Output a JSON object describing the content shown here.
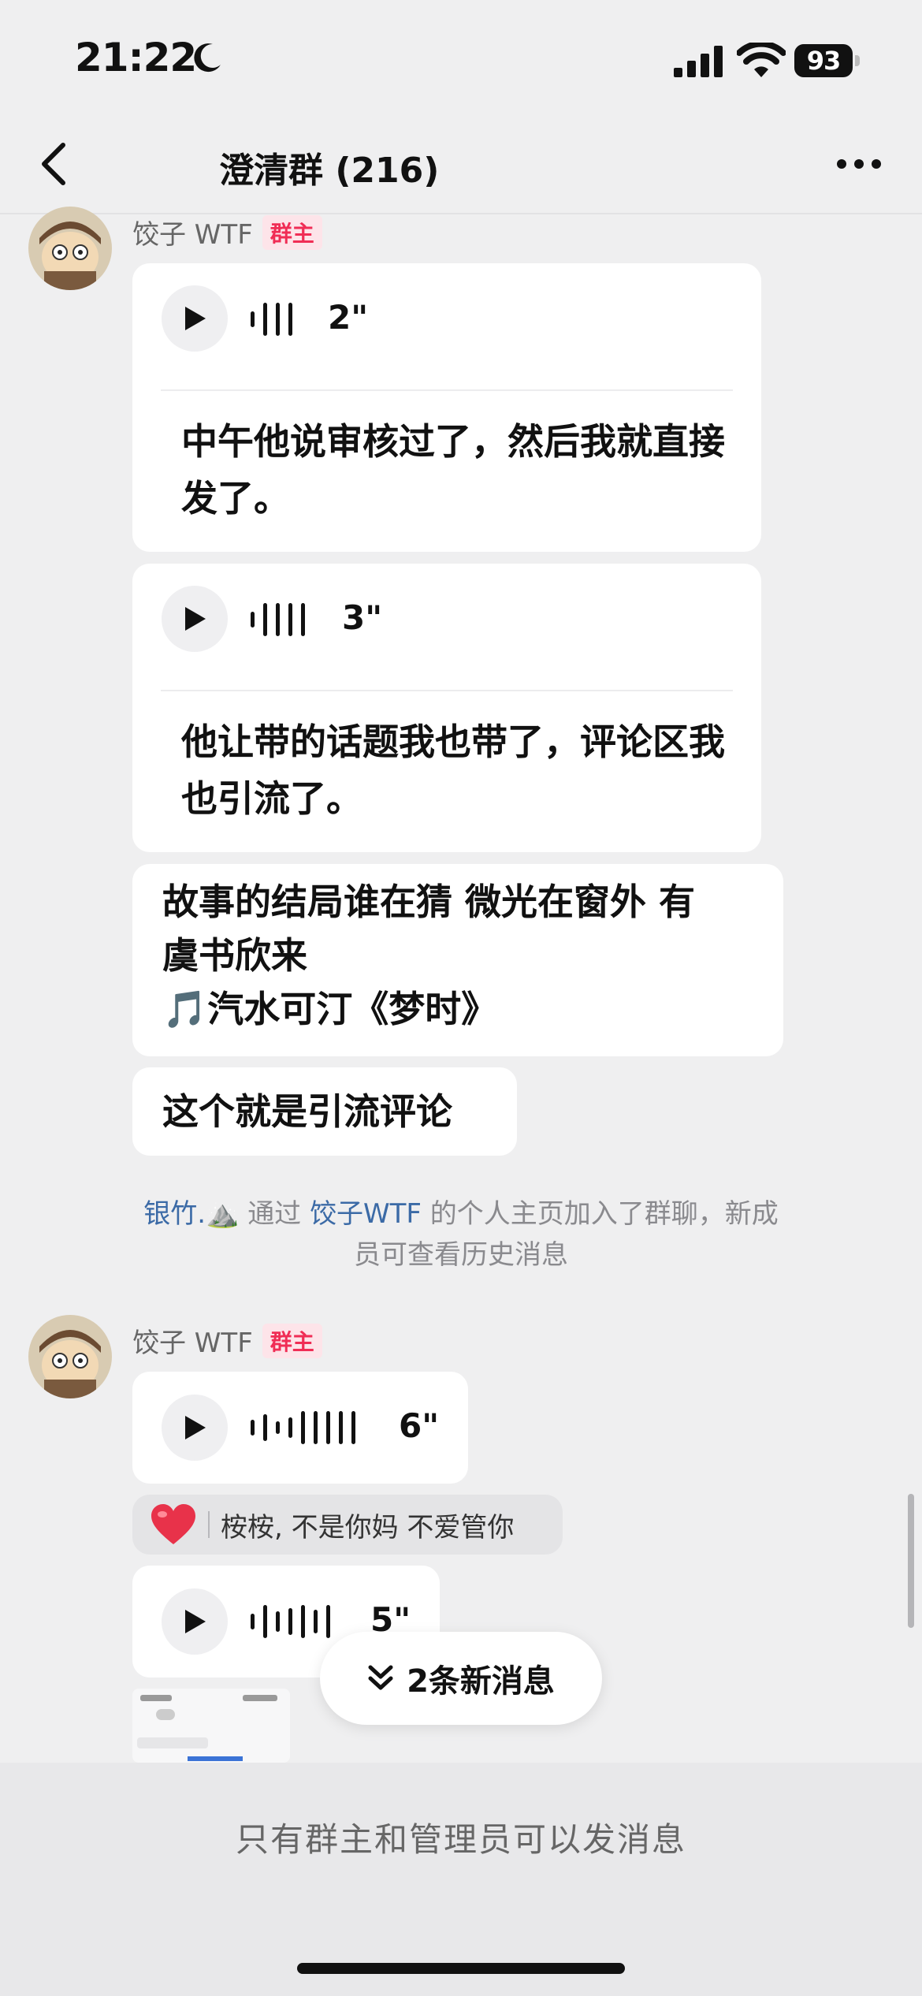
{
  "status_bar": {
    "time": "21:22",
    "battery": "93"
  },
  "nav": {
    "title": "澄清群 (216)"
  },
  "messages": {
    "sender_name": "饺子 WTF",
    "owner_badge": "群主",
    "voice1": {
      "duration": "2\"",
      "transcript": "中午他说审核过了，然后我就直接发了。"
    },
    "voice2": {
      "duration": "3\"",
      "transcript": "他让带的话题我也带了，评论区我也引流了。"
    },
    "text1": {
      "line1": "故事的结局谁在猜 微光在窗外 有",
      "line2": "虞书欣来",
      "line3": "🎵汽水可汀《梦时》"
    },
    "text2": "这个就是引流评论",
    "system_notice": {
      "user": "银竹.⛰️",
      "via": "通过",
      "inviter": "饺子WTF",
      "rest1": "的个人主页加入了群聊，新成",
      "rest2": "员可查看历史消息"
    },
    "sender_name2": "饺子 WTF",
    "owner_badge2": "群主",
    "voice3": {
      "duration": "6\""
    },
    "reaction": {
      "emoji": "❤️",
      "text": "桉桉, 不是你妈 不爱管你"
    },
    "voice4": {
      "duration": "5\""
    }
  },
  "new_messages_button": "2条新消息",
  "footer": {
    "notice": "只有群主和管理员可以发消息"
  },
  "colors": {
    "badge": "#f02d55",
    "link": "#3b6aa6",
    "background": "#efeff0"
  }
}
